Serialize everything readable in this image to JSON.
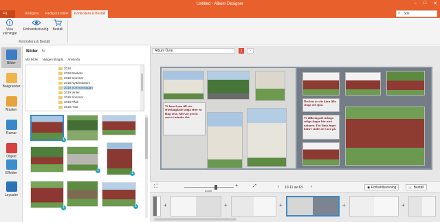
{
  "window": {
    "title": "Untitled - Album Designer",
    "minimize": "–",
    "maximize": "□",
    "close": "✕"
  },
  "tabs": {
    "file": "FIL",
    "items": [
      "Redigera",
      "Redigera bilder",
      "Kontrollera & Beställ"
    ],
    "active_index": 2
  },
  "search": {
    "placeholder": "Sök",
    "value": ""
  },
  "ribbon": {
    "buttons": [
      {
        "label": "Visa varningar",
        "icon": "warning-icon"
      },
      {
        "label": "Förhandsvisning",
        "icon": "eye-icon"
      },
      {
        "label": "Beställ",
        "icon": "cart-icon"
      }
    ],
    "group_label": "Kontrollera & Beställ"
  },
  "nav": [
    {
      "label": "Bilder",
      "icon": "photos-icon",
      "active": true
    },
    {
      "label": "Bakgrunder",
      "icon": "backgrounds-icon"
    },
    {
      "label": "Masker",
      "icon": "masks-icon"
    },
    {
      "label": "Ramar",
      "icon": "frames-icon"
    },
    {
      "label": "Objekt",
      "icon": "objects-icon"
    },
    {
      "label": "Effekter",
      "icon": "effects-icon"
    },
    {
      "label": "Layouter",
      "icon": "layouts-icon"
    }
  ],
  "panel": {
    "title": "Bilder",
    "refresh_icon": "↻",
    "subtabs": [
      "Alla bilder",
      "Nyligen tillagda",
      "Använda"
    ],
    "tree": [
      {
        "label": "2018"
      },
      {
        "label": "2018 Baskets"
      },
      {
        "label": "2018 Sommar"
      },
      {
        "label": "2018 Nyttårsdatum"
      },
      {
        "label": "2018 Sommarstugan",
        "selected": true
      },
      {
        "label": "2019 Vinter"
      },
      {
        "label": "2019 Sommar"
      },
      {
        "label": "2019 Påsk"
      },
      {
        "label": "2019 Höst"
      },
      {
        "label": "2019 Förberedelser"
      }
    ],
    "badge_value": "1"
  },
  "editor": {
    "page_name": "Album Övre",
    "page_badge": "1",
    "next_arrow": "›",
    "captions": {
      "left": "Vi kom fram till vår efterlängtade stuga efter en lång resa. Allt var precis som vi mindes det.",
      "right_top": "Det här är vår kära lilla stuga vid sjön.",
      "right_mid": "Vi tillbringade många soliga dagar här ute i naturen. Det finns inget bättre ställe att vara på."
    }
  },
  "bottombar": {
    "zoom_label": "Zoom",
    "page_counter": "10-11 av 63",
    "preview_button": "Förhandsvisning",
    "order_button": "Beställ"
  },
  "filmstrip": {
    "add_symbol": "+"
  },
  "colors": {
    "accent": "#e8612c",
    "accent_dark": "#c9481a",
    "selection": "#3a88c8",
    "badge": "#29a8b8",
    "caption": "#8a1f2a"
  }
}
